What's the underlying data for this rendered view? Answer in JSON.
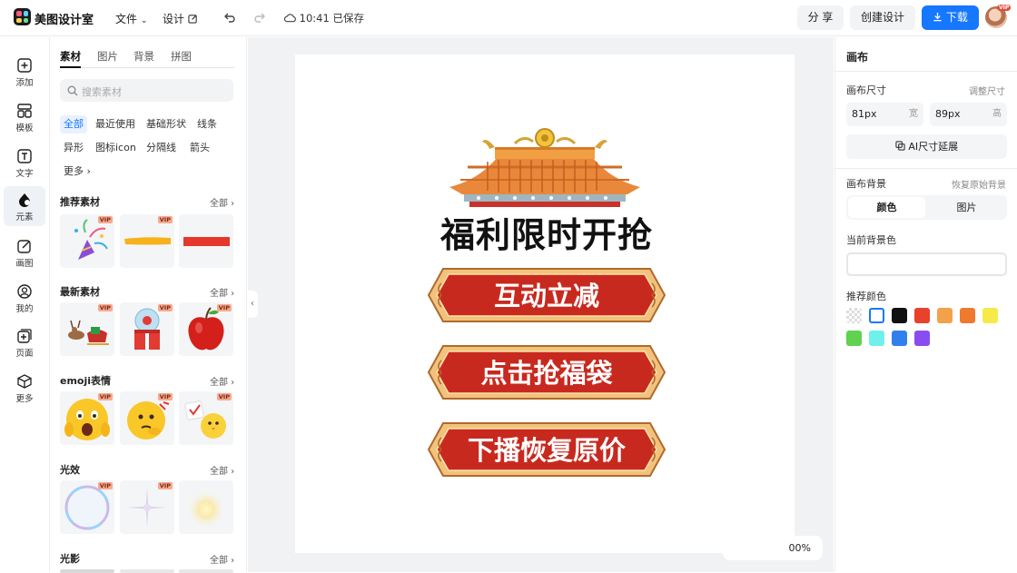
{
  "header": {
    "brand": "美图设计室",
    "menu_file": "文件",
    "menu_design": "设计",
    "save_status": "10:41 已保存",
    "share_label": "分 享",
    "create_label": "创建设计",
    "download_label": "下载",
    "avatar_badge": "VIP"
  },
  "left_rail": {
    "items": [
      {
        "label": "添加",
        "icon": "plus-square-icon"
      },
      {
        "label": "模板",
        "icon": "layout-icon"
      },
      {
        "label": "文字",
        "icon": "text-icon"
      },
      {
        "label": "元素",
        "icon": "shapes-icon"
      },
      {
        "label": "画图",
        "icon": "pencil-icon"
      },
      {
        "label": "我的",
        "icon": "user-icon"
      },
      {
        "label": "页面",
        "icon": "add-page-icon"
      },
      {
        "label": "更多",
        "icon": "cube-icon"
      }
    ],
    "active_index": 3
  },
  "panel": {
    "tabs": [
      "素材",
      "图片",
      "背景",
      "拼图"
    ],
    "search_placeholder": "搜索素材",
    "chips": [
      "全部",
      "最近使用",
      "基础形状",
      "线条",
      "异形",
      "图标icon",
      "分隔线",
      "箭头",
      "更多"
    ],
    "all_label": "全部",
    "vip": "VIP",
    "sections": [
      {
        "title": "推荐素材",
        "items": [
          "party-popper",
          "yellow-brush-stroke",
          "red-bar"
        ]
      },
      {
        "title": "最新素材",
        "items": [
          "reindeer-sleigh",
          "gift-box",
          "red-apple"
        ]
      },
      {
        "title": "emoji表情",
        "items": [
          "scared-face",
          "thinking-face",
          "chick-sticker"
        ]
      },
      {
        "title": "光效",
        "items": [
          "bubble-ring",
          "sparkle-cross",
          "soft-glow"
        ]
      },
      {
        "title": "光影",
        "items": []
      }
    ]
  },
  "canvas": {
    "title": "福利限时开抢",
    "buttons": [
      "互动立减",
      "点击抢福袋",
      "下播恢复原价"
    ],
    "zoom_label": "00%"
  },
  "right_panel": {
    "title": "画布",
    "size_label": "画布尺寸",
    "adjust_label": "调整尺寸",
    "width_value": "81px",
    "width_unit": "宽",
    "height_value": "89px",
    "height_unit": "高",
    "ai_extend": "AI尺寸延展",
    "bg_label": "画布背景",
    "restore_label": "恢复原始背景",
    "tab_color": "颜色",
    "tab_image": "图片",
    "current_bg_label": "当前背景色",
    "recommended_label": "推荐颜色",
    "swatches": [
      "transparent",
      "#ffffff",
      "#111111",
      "#e8412c",
      "#f3a24b",
      "#ee7a2e",
      "#f6e94a",
      "#5fd24f",
      "#6ff0ea",
      "#2f80ed",
      "#8a4cf0"
    ]
  },
  "colors": {
    "accent": "#1677ff",
    "button_red": "#c8291f",
    "button_gold": "#f1c27d"
  }
}
